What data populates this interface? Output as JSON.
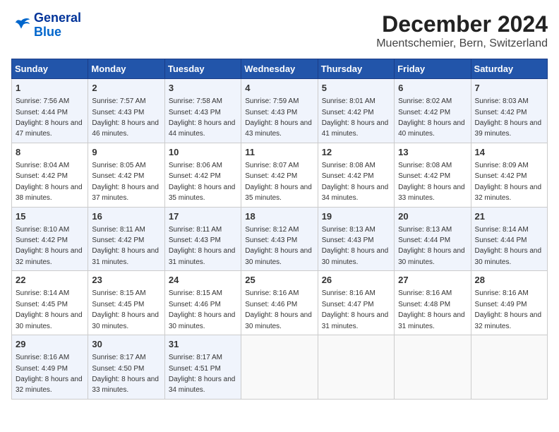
{
  "logo": {
    "line1": "General",
    "line2": "Blue"
  },
  "title": "December 2024",
  "subtitle": "Muentschemier, Bern, Switzerland",
  "days_of_week": [
    "Sunday",
    "Monday",
    "Tuesday",
    "Wednesday",
    "Thursday",
    "Friday",
    "Saturday"
  ],
  "weeks": [
    [
      {
        "day": "1",
        "sunrise": "7:56 AM",
        "sunset": "4:44 PM",
        "daylight": "8 hours and 47 minutes."
      },
      {
        "day": "2",
        "sunrise": "7:57 AM",
        "sunset": "4:43 PM",
        "daylight": "8 hours and 46 minutes."
      },
      {
        "day": "3",
        "sunrise": "7:58 AM",
        "sunset": "4:43 PM",
        "daylight": "8 hours and 44 minutes."
      },
      {
        "day": "4",
        "sunrise": "7:59 AM",
        "sunset": "4:43 PM",
        "daylight": "8 hours and 43 minutes."
      },
      {
        "day": "5",
        "sunrise": "8:01 AM",
        "sunset": "4:42 PM",
        "daylight": "8 hours and 41 minutes."
      },
      {
        "day": "6",
        "sunrise": "8:02 AM",
        "sunset": "4:42 PM",
        "daylight": "8 hours and 40 minutes."
      },
      {
        "day": "7",
        "sunrise": "8:03 AM",
        "sunset": "4:42 PM",
        "daylight": "8 hours and 39 minutes."
      }
    ],
    [
      {
        "day": "8",
        "sunrise": "8:04 AM",
        "sunset": "4:42 PM",
        "daylight": "8 hours and 38 minutes."
      },
      {
        "day": "9",
        "sunrise": "8:05 AM",
        "sunset": "4:42 PM",
        "daylight": "8 hours and 37 minutes."
      },
      {
        "day": "10",
        "sunrise": "8:06 AM",
        "sunset": "4:42 PM",
        "daylight": "8 hours and 35 minutes."
      },
      {
        "day": "11",
        "sunrise": "8:07 AM",
        "sunset": "4:42 PM",
        "daylight": "8 hours and 35 minutes."
      },
      {
        "day": "12",
        "sunrise": "8:08 AM",
        "sunset": "4:42 PM",
        "daylight": "8 hours and 34 minutes."
      },
      {
        "day": "13",
        "sunrise": "8:08 AM",
        "sunset": "4:42 PM",
        "daylight": "8 hours and 33 minutes."
      },
      {
        "day": "14",
        "sunrise": "8:09 AM",
        "sunset": "4:42 PM",
        "daylight": "8 hours and 32 minutes."
      }
    ],
    [
      {
        "day": "15",
        "sunrise": "8:10 AM",
        "sunset": "4:42 PM",
        "daylight": "8 hours and 32 minutes."
      },
      {
        "day": "16",
        "sunrise": "8:11 AM",
        "sunset": "4:42 PM",
        "daylight": "8 hours and 31 minutes."
      },
      {
        "day": "17",
        "sunrise": "8:11 AM",
        "sunset": "4:43 PM",
        "daylight": "8 hours and 31 minutes."
      },
      {
        "day": "18",
        "sunrise": "8:12 AM",
        "sunset": "4:43 PM",
        "daylight": "8 hours and 30 minutes."
      },
      {
        "day": "19",
        "sunrise": "8:13 AM",
        "sunset": "4:43 PM",
        "daylight": "8 hours and 30 minutes."
      },
      {
        "day": "20",
        "sunrise": "8:13 AM",
        "sunset": "4:44 PM",
        "daylight": "8 hours and 30 minutes."
      },
      {
        "day": "21",
        "sunrise": "8:14 AM",
        "sunset": "4:44 PM",
        "daylight": "8 hours and 30 minutes."
      }
    ],
    [
      {
        "day": "22",
        "sunrise": "8:14 AM",
        "sunset": "4:45 PM",
        "daylight": "8 hours and 30 minutes."
      },
      {
        "day": "23",
        "sunrise": "8:15 AM",
        "sunset": "4:45 PM",
        "daylight": "8 hours and 30 minutes."
      },
      {
        "day": "24",
        "sunrise": "8:15 AM",
        "sunset": "4:46 PM",
        "daylight": "8 hours and 30 minutes."
      },
      {
        "day": "25",
        "sunrise": "8:16 AM",
        "sunset": "4:46 PM",
        "daylight": "8 hours and 30 minutes."
      },
      {
        "day": "26",
        "sunrise": "8:16 AM",
        "sunset": "4:47 PM",
        "daylight": "8 hours and 31 minutes."
      },
      {
        "day": "27",
        "sunrise": "8:16 AM",
        "sunset": "4:48 PM",
        "daylight": "8 hours and 31 minutes."
      },
      {
        "day": "28",
        "sunrise": "8:16 AM",
        "sunset": "4:49 PM",
        "daylight": "8 hours and 32 minutes."
      }
    ],
    [
      {
        "day": "29",
        "sunrise": "8:16 AM",
        "sunset": "4:49 PM",
        "daylight": "8 hours and 32 minutes."
      },
      {
        "day": "30",
        "sunrise": "8:17 AM",
        "sunset": "4:50 PM",
        "daylight": "8 hours and 33 minutes."
      },
      {
        "day": "31",
        "sunrise": "8:17 AM",
        "sunset": "4:51 PM",
        "daylight": "8 hours and 34 minutes."
      },
      null,
      null,
      null,
      null
    ]
  ]
}
